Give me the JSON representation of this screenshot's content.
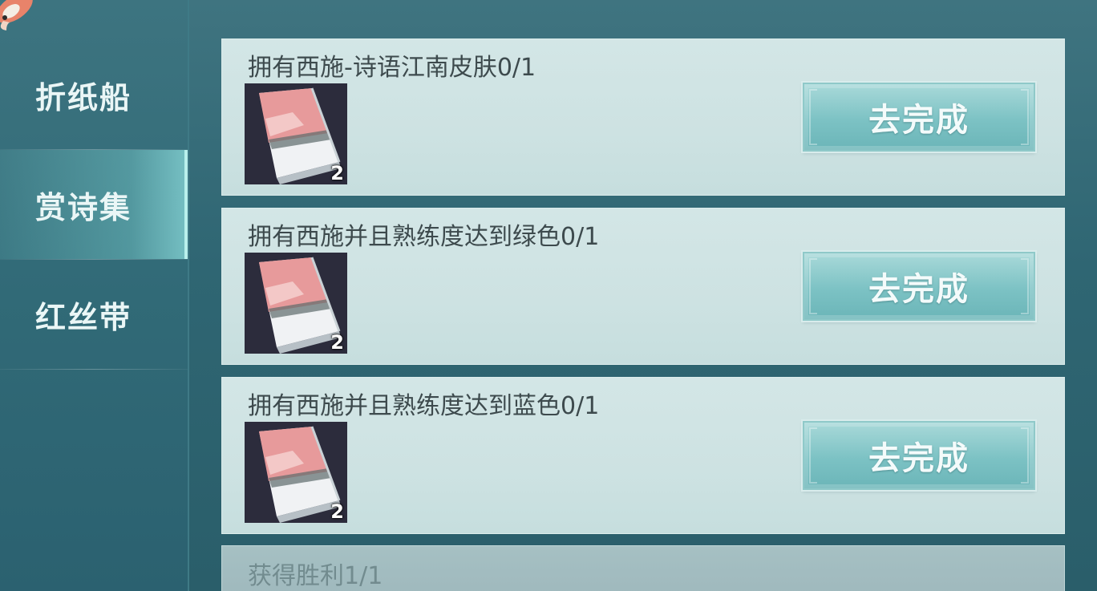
{
  "sidebar": {
    "tabs": [
      {
        "label": "折纸船",
        "active": false
      },
      {
        "label": "赏诗集",
        "active": true
      },
      {
        "label": "红丝带",
        "active": false
      }
    ]
  },
  "tasks": [
    {
      "title": "拥有西施-诗语江南皮肤0/1",
      "reward_count": "2",
      "button": "去完成"
    },
    {
      "title": "拥有西施并且熟练度达到绿色0/1",
      "reward_count": "2",
      "button": "去完成"
    },
    {
      "title": "拥有西施并且熟练度达到蓝色0/1",
      "reward_count": "2",
      "button": "去完成"
    },
    {
      "title": "获得胜利1/1"
    }
  ],
  "icons": {
    "reward_item": "poetry-book-icon",
    "corner_decoration": "koi-fish-icon"
  },
  "colors": {
    "background": "#2f6673",
    "card": "#cde2e2",
    "button": "#7cc2c4",
    "active_tab": "#8cdcdc"
  }
}
